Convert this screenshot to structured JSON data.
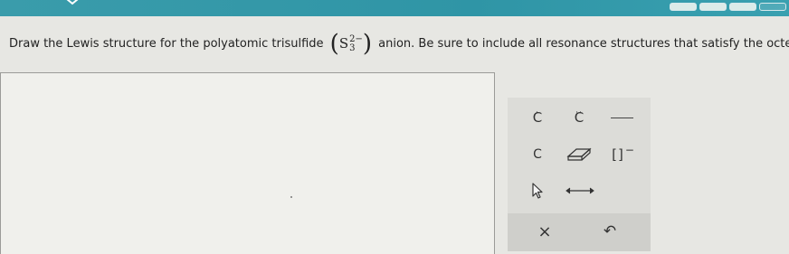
{
  "progress": {
    "segments": 5,
    "completed": 3
  },
  "question": {
    "before": "Draw the Lewis structure for the polyatomic trisulfide",
    "ion_symbol": "S",
    "ion_charge": "2−",
    "ion_subscript": "3",
    "after": "anion. Be sure to include all resonance structures that satisfy the octet rule."
  },
  "palette": {
    "atom_c_dot": "C",
    "atom_c_dots": "C",
    "atom_c_plain": "C",
    "bracket_text": "[]",
    "bracket_charge": "−"
  },
  "controls": {
    "close_label": "×",
    "undo_label": "↶"
  },
  "colors": {
    "header": "#2f95a6",
    "background": "#e7e7e3",
    "palette_bg": "#dcdcd8",
    "canvas_bg": "#f0f0ec"
  }
}
